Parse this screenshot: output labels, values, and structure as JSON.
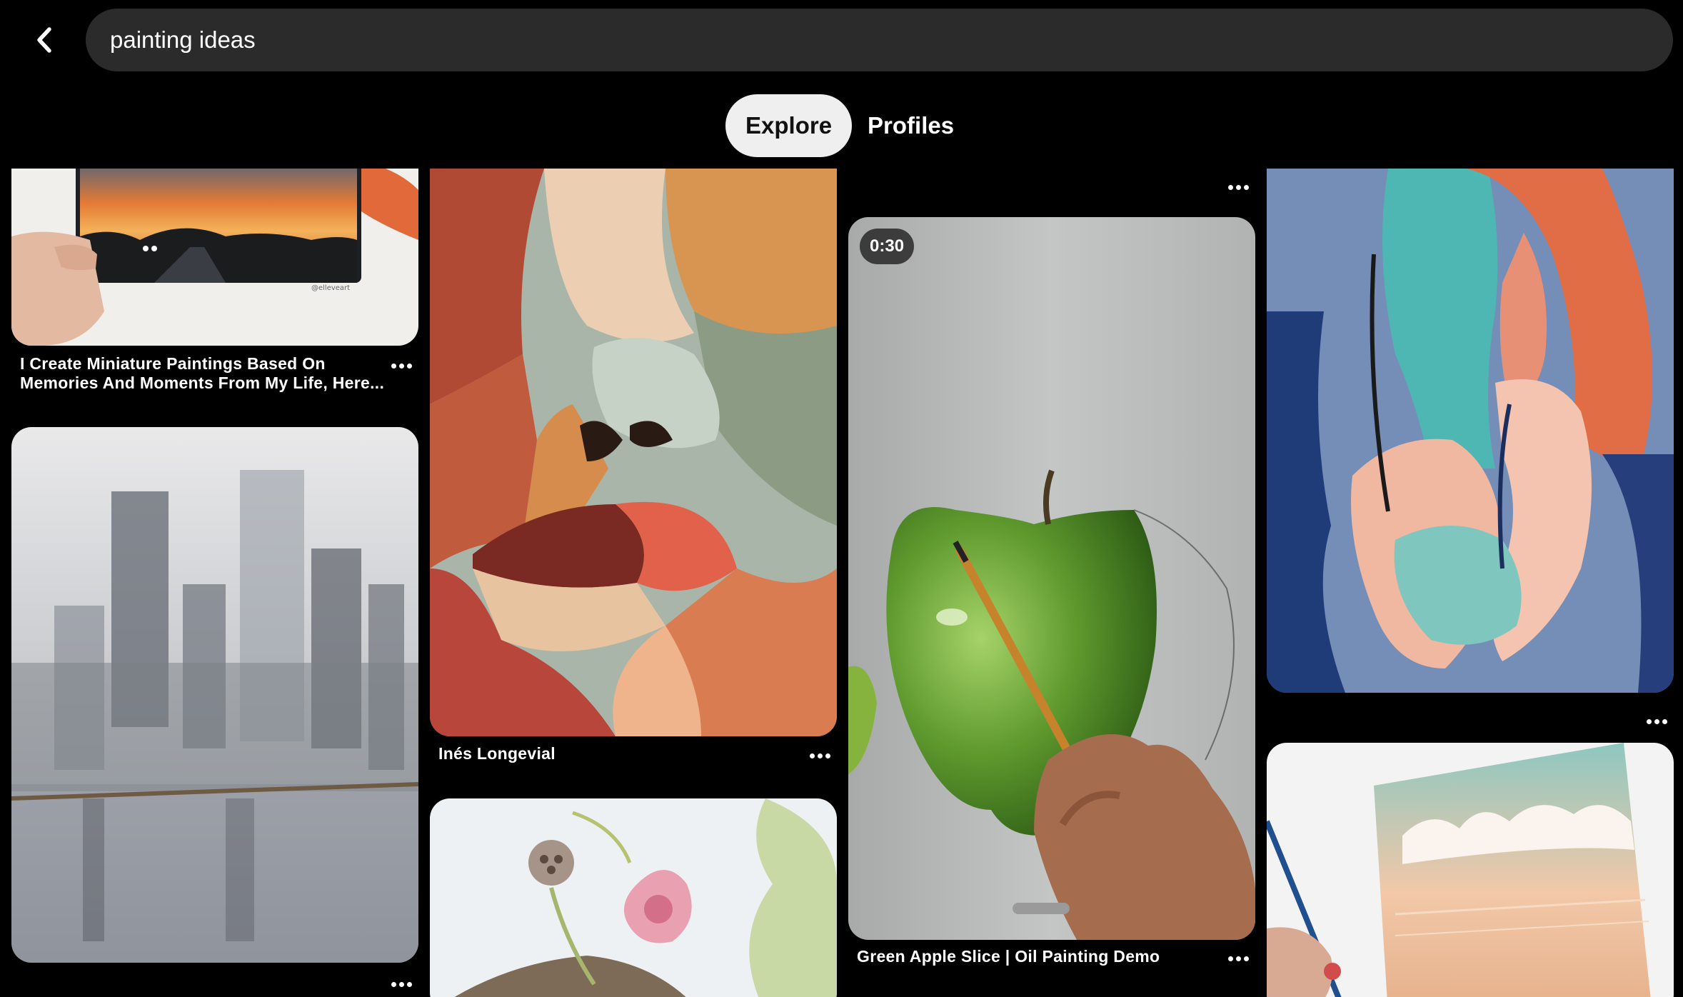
{
  "search": {
    "query": "painting ideas"
  },
  "tabs": [
    {
      "label": "Explore",
      "active": true
    },
    {
      "label": "Profiles",
      "active": false
    }
  ],
  "pins": [
    {
      "title": "I Create Miniature Paintings Based On Memories And Moments From My Life, Here..."
    },
    {
      "title": ""
    },
    {
      "title": "Inés Longevial"
    },
    {
      "title": ""
    },
    {
      "title": "Green Apple Slice | Oil Painting Demo",
      "duration": "0:30"
    },
    {
      "title": ""
    },
    {
      "title": ""
    }
  ]
}
